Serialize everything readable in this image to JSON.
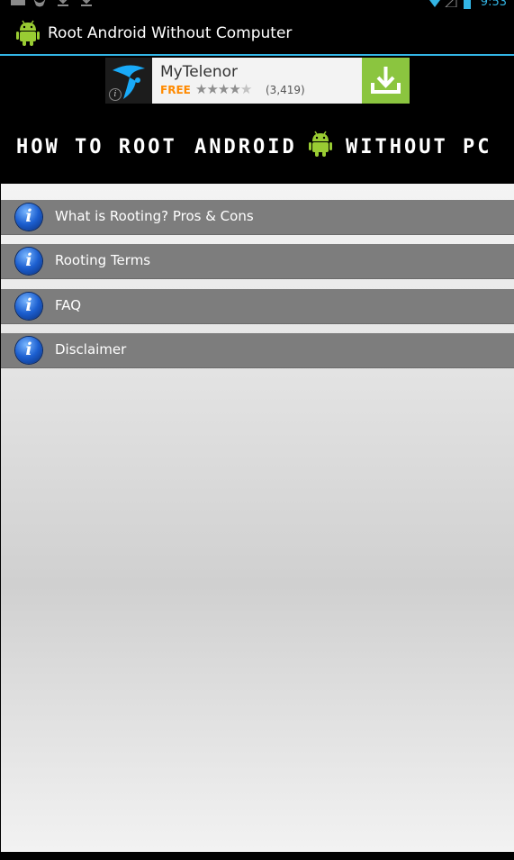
{
  "status_bar": {
    "time": "9:53",
    "icons": [
      "image-notification-icon",
      "bird-notification-icon",
      "download-icon",
      "download-icon",
      "wifi-icon",
      "signal-icon",
      "battery-icon"
    ]
  },
  "action_bar": {
    "title": "Root Android Without Computer",
    "icon": "android-robot-icon",
    "accent_color": "#33b5e5"
  },
  "ad": {
    "app_name": "MyTelenor",
    "price": "FREE",
    "rating_stars": 4,
    "rating_count": "(3,419)",
    "download_color": "#8bc53f",
    "icons": [
      "telenor-logo-icon",
      "ad-info-icon",
      "star-icon",
      "download-icon"
    ]
  },
  "hero": {
    "part_a": "HOW TO ROOT",
    "part_b": "ANDROID",
    "part_c": "WITHOUT PC",
    "icon": "android-robot-icon"
  },
  "menu": {
    "items": [
      {
        "label": "What is Rooting? Pros & Cons",
        "icon": "info-icon"
      },
      {
        "label": "Rooting Terms",
        "icon": "info-icon"
      },
      {
        "label": "FAQ",
        "icon": "info-icon"
      },
      {
        "label": "Disclaimer",
        "icon": "info-icon"
      }
    ]
  }
}
